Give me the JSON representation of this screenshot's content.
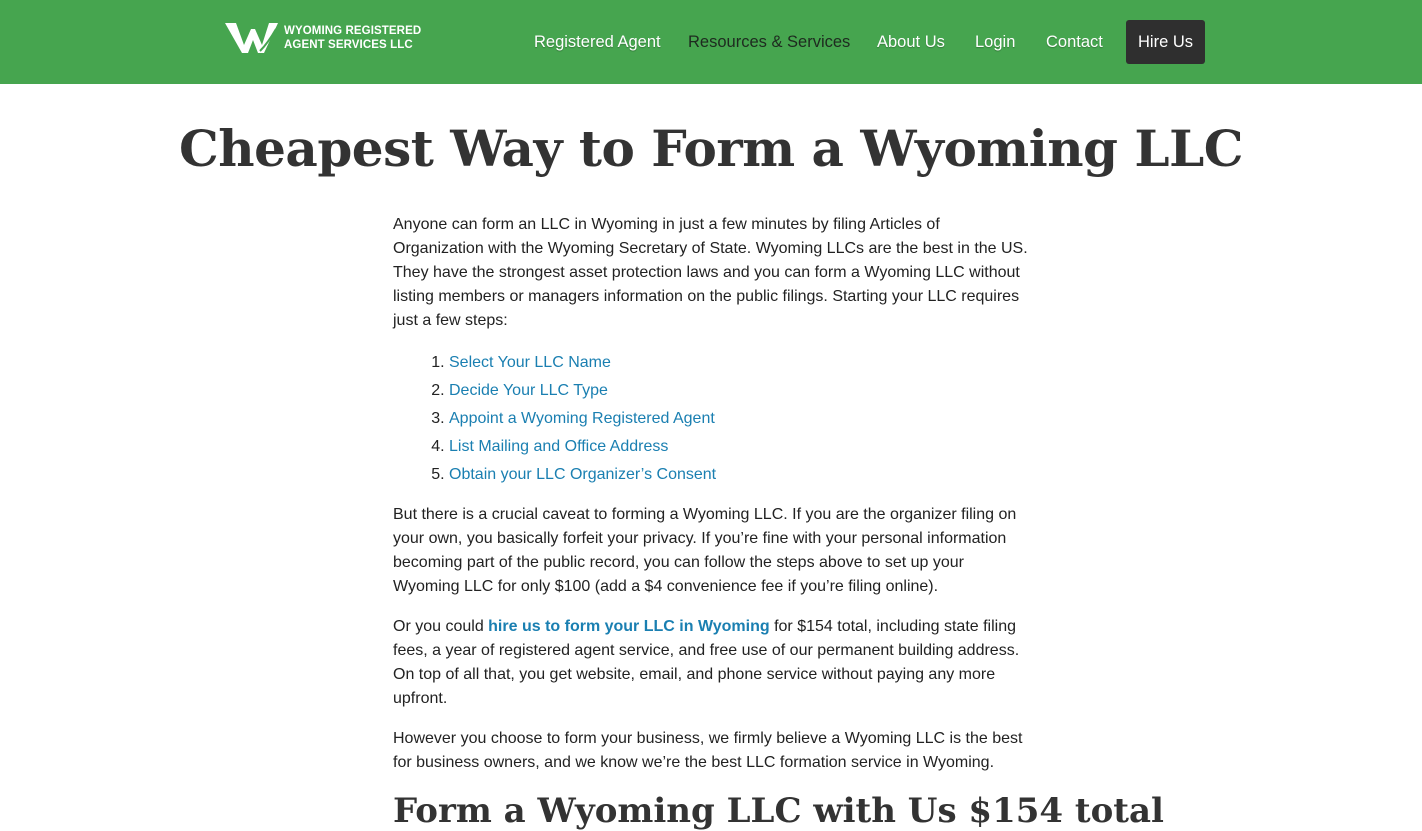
{
  "header": {
    "logo_line1": "Wyoming Registered",
    "logo_line2": "Agent Services LLC",
    "nav": [
      {
        "label": "Registered Agent"
      },
      {
        "label": "Resources & Services"
      },
      {
        "label": "About Us"
      },
      {
        "label": "Login"
      },
      {
        "label": "Contact"
      }
    ],
    "cta": "Hire Us"
  },
  "main": {
    "title": "Cheapest Way to Form a Wyoming LLC",
    "intro": "Anyone can form an LLC in Wyoming in just a few minutes by filing Articles of Organization with the Wyoming Secretary of State. Wyoming LLCs are the best in the US. They have the strongest asset protection laws and you can form a Wyoming LLC without listing members or managers information on the public filings. Starting your LLC requires just a few steps:",
    "steps": [
      "Select Your LLC Name",
      "Decide Your LLC Type",
      "Appoint a Wyoming Registered Agent",
      "List Mailing and Office Address",
      "Obtain your LLC Organizer’s Consent"
    ],
    "caveat": "But there is a crucial caveat to forming a Wyoming LLC. If you are the organizer filing on your own, you basically forfeit your privacy. If you’re fine with your personal information becoming part of the public record, you can follow the steps above to set up your Wyoming LLC for only $100 (add a $4 convenience fee if you’re filing online).",
    "offer_pre": "Or you could ",
    "offer_link": "hire us to form your LLC in Wyoming",
    "offer_post": " for $154 total, including state filing fees, a year of registered agent service, and free use of our permanent building address. On top of all that, you get website, email, and phone service without paying any more upfront.",
    "closing": "However you choose to form your business, we firmly believe a Wyoming LLC is the best for business owners, and we know we’re the best LLC formation service in Wyoming.",
    "next_heading": "Form a Wyoming LLC with Us $154 total"
  },
  "colors": {
    "header_bg": "#46a54f",
    "cta_bg": "#2f2f2f",
    "link": "#1a7fb1"
  }
}
